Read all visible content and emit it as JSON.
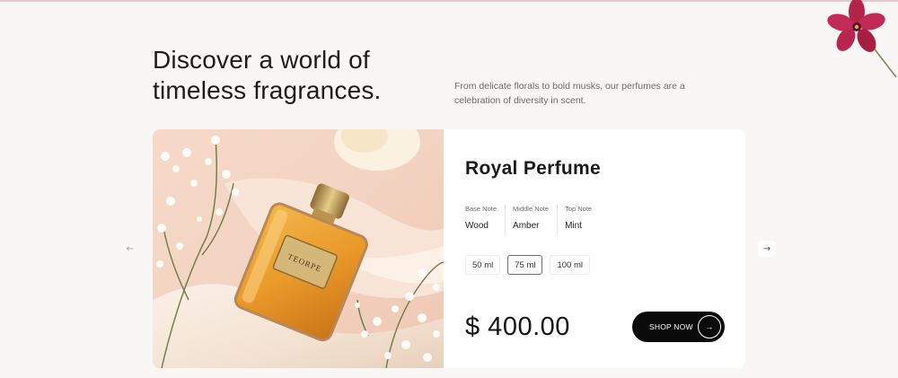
{
  "headline": {
    "line1": "Discover a world of",
    "line2": "timeless fragrances."
  },
  "subtext": "From delicate florals to bold musks, our perfumes are a celebration of diversity in scent.",
  "product": {
    "title": "Royal Perfume",
    "bottle_label": "TEORPE",
    "notes": [
      {
        "label": "Base Note",
        "value": "Wood"
      },
      {
        "label": "Middle Note",
        "value": "Amber"
      },
      {
        "label": "Top Note",
        "value": "Mint"
      }
    ],
    "sizes": [
      "50 ml",
      "75 ml",
      "100 ml"
    ],
    "selected_size": "75 ml",
    "price": "$ 400.00",
    "cta_label": "SHOP NOW"
  },
  "icons": {
    "prev": "arrow-left-icon",
    "next": "arrow-right-icon",
    "cta": "arrow-right-circle-icon"
  },
  "colors": {
    "background": "#f9f7f5",
    "cta_background": "#0b0b0b",
    "accent_flower": "#b5204a"
  }
}
